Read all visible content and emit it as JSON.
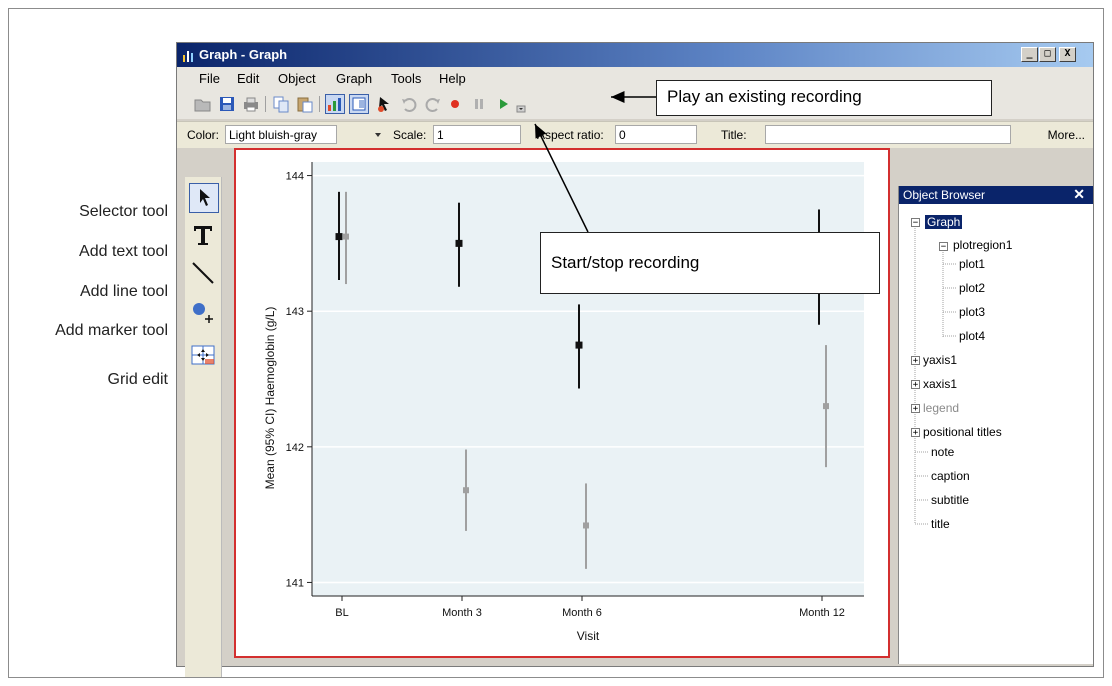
{
  "left_labels": {
    "selector": "Selector tool",
    "text": "Add text tool",
    "line": "Add line tool",
    "marker": "Add marker tool",
    "grid": "Grid edit"
  },
  "window": {
    "title": "Graph - Graph",
    "controls": {
      "minimize": "_",
      "maximize": "□",
      "close": "X"
    }
  },
  "menu": [
    "File",
    "Edit",
    "Object",
    "Graph",
    "Tools",
    "Help"
  ],
  "toolbar_icons": [
    "open-icon",
    "save-icon",
    "print-icon",
    "copy-icon",
    "paste-icon",
    "graph-editor-icon",
    "object-browser-icon",
    "pointer-icon",
    "undo-icon",
    "redo-icon",
    "record-icon",
    "pause-icon",
    "play-icon",
    "toolbar-options-icon"
  ],
  "properties": {
    "color_label": "Color:",
    "color_value": "Light bluish-gray",
    "scale_label": "Scale:",
    "scale_value": "1",
    "aspect_label": "Aspect ratio:",
    "aspect_value": "0",
    "title_label": "Title:",
    "title_value": "",
    "more": "More..."
  },
  "callouts": {
    "play": "Play an existing recording",
    "record": "Start/stop recording"
  },
  "object_browser": {
    "title": "Object Browser",
    "close": "✕",
    "nodes": {
      "graph": "Graph",
      "plotregion1": "plotregion1",
      "plot1": "plot1",
      "plot2": "plot2",
      "plot3": "plot3",
      "plot4": "plot4",
      "yaxis1": "yaxis1",
      "xaxis1": "xaxis1",
      "legend": "legend",
      "positional_titles": "positional titles",
      "note": "note",
      "caption": "caption",
      "subtitle": "subtitle",
      "title": "title"
    }
  },
  "chart_data": {
    "type": "scatter",
    "title": "",
    "xlabel": "Visit",
    "ylabel": "Mean (95% CI) Haemoglobin (g/L)",
    "categories": [
      "BL",
      "Month 3",
      "Month 6",
      "Month 12"
    ],
    "x_positions": [
      0,
      3,
      6,
      12
    ],
    "ylim": [
      140.9,
      144.1
    ],
    "yticks": [
      141,
      142,
      143,
      144
    ],
    "grid": true,
    "legend": "none",
    "series": [
      {
        "color": "#111111",
        "x": [
          0,
          3,
          6,
          12
        ],
        "mean": [
          143.55,
          143.5,
          142.75,
          143.35
        ],
        "lower": [
          143.23,
          143.18,
          142.43,
          142.9
        ],
        "upper": [
          143.88,
          143.8,
          143.05,
          143.75
        ]
      },
      {
        "color": "#a0a0a0",
        "x": [
          0,
          3,
          6,
          12
        ],
        "mean": [
          143.55,
          141.68,
          141.42,
          142.3
        ],
        "lower": [
          143.2,
          141.38,
          141.1,
          141.85
        ],
        "upper": [
          143.88,
          141.98,
          141.73,
          142.75
        ]
      }
    ]
  }
}
